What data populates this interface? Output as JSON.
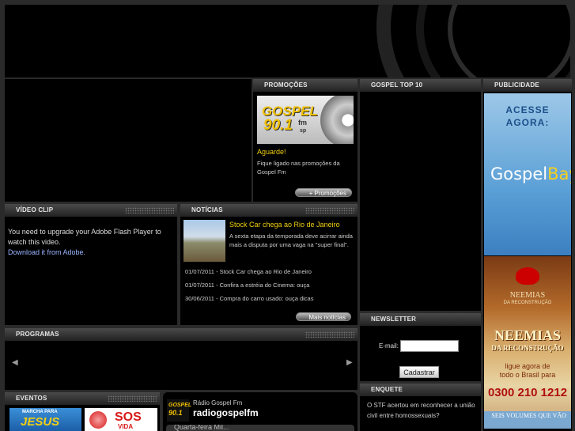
{
  "header": {
    "title": ""
  },
  "promocoes": {
    "title": "PROMOÇÕES",
    "logo_text": "GOSPEL",
    "logo_freq": "90.1",
    "logo_unit": "fm",
    "logo_sub": "sp",
    "heading": "Aguarde!",
    "text": "Fique ligado nas promoções da Gospel Fm",
    "button": "+ Promoções"
  },
  "top10": {
    "title": "GOSPEL TOP 10"
  },
  "publicidade": {
    "title": "PUBLICIDADE",
    "ad1_line1": "ACESSE",
    "ad1_line2": "AGORA:",
    "ad1_brand_a": "Gospel",
    "ad1_brand_b": "Bay",
    "ad2_title": "NEEMIAS",
    "ad2_sub": "DA RECONSTRUÇÃO",
    "ad2_big": "NEEMIAS",
    "ad2_big_sub": "DA RECONSTRUÇÃO",
    "ad2_call": "ligue agora de",
    "ad2_call2": "todo o Brasil para",
    "ad2_phone": "0300 210 1212",
    "ad3_text": "SEIS VOLUMES QUE VÃO"
  },
  "videoclip": {
    "title": "VÍDEO CLIP",
    "message": "You need to upgrade your Adobe Flash Player to watch this video.",
    "link": "Download it from Adobe."
  },
  "noticias": {
    "title": "NOTÍCIAS",
    "featured_title": "Stock Car chega ao Rio de Janeiro",
    "featured_text": "A sexta etapa da temporada deve acirrar ainda mais a disputa por uma vaga na \"super final\".",
    "items": [
      {
        "text": "01/07/2011 - Stock Car chega ao Rio de Janeiro"
      },
      {
        "text": "01/07/2011 - Confira a estréia do Cinema: ouça"
      },
      {
        "text": "30/06/2011 - Compra do carro usado: ouça dicas"
      }
    ],
    "button": "Mais notícias"
  },
  "newsletter": {
    "title": "NEWSLETTER",
    "email_label": "E-mail:",
    "email_value": "",
    "submit": "Cadastrar"
  },
  "programas": {
    "title": "PROGRAMAS",
    "prev": "◀",
    "next": "▶"
  },
  "enquete": {
    "title": "ENQUETE",
    "option": "O STF acertou em reconhecer a união civil entre homossexuais?"
  },
  "eventos": {
    "title": "EVENTOS",
    "banner1": "MARCHA PARA",
    "banner1_big": "JESUS",
    "banner2": "SOS",
    "banner2_sub": "VIDA"
  },
  "social": {
    "logo_text": "GOSPEL",
    "logo_freq": "90.1",
    "name": "Rádio Gospel Fm",
    "handle": "radiogospelfm",
    "tweet": "Quarta-feira Mil..."
  }
}
